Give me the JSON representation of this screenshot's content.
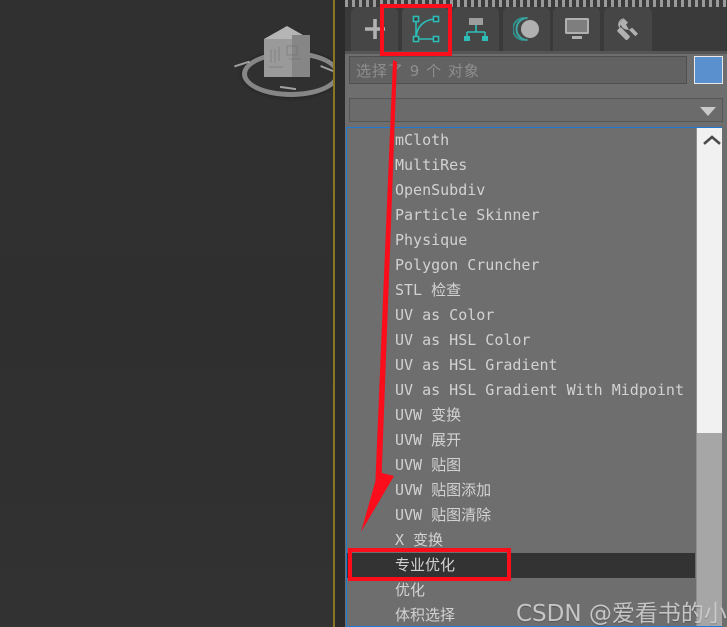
{
  "app": {
    "name": "3ds Max Command Panel",
    "accent_blue": "#1e7ad4",
    "panel_bg": "#6e6e6e",
    "annotation_red": "#fb0d1b",
    "swatch_color": "#5a90ce",
    "tab_icon_teal": "#2dbdb6"
  },
  "viewport": {
    "label": "viewport-3d",
    "object": "cube-with-ring"
  },
  "tabs": [
    {
      "id": "create",
      "icon": "plus-icon",
      "label": "创建",
      "selected": false
    },
    {
      "id": "modify",
      "icon": "modify-icon",
      "label": "修改",
      "selected": true
    },
    {
      "id": "hierarchy",
      "icon": "hierarchy-icon",
      "label": "层次",
      "selected": false
    },
    {
      "id": "motion",
      "icon": "motion-icon",
      "label": "运动",
      "selected": false
    },
    {
      "id": "display",
      "icon": "display-icon",
      "label": "显示",
      "selected": false
    },
    {
      "id": "utilities",
      "icon": "wrench-icon",
      "label": "工具",
      "selected": false
    }
  ],
  "name_field": {
    "value": "选择了 9 个 对象",
    "placeholder": "选择了 9 个 对象",
    "color_swatch": "#5a90ce"
  },
  "modifier_dropdown": {
    "value": "",
    "caret_icon": "chevron-down-icon"
  },
  "modifier_list": {
    "items": [
      "mCloth",
      "MultiRes",
      "OpenSubdiv",
      "Particle Skinner",
      "Physique",
      "Polygon Cruncher",
      "STL 检查",
      "UV as Color",
      "UV as HSL Color",
      "UV as HSL Gradient",
      "UV as HSL Gradient With Midpoint",
      "UVW 变换",
      "UVW 展开",
      "UVW 贴图",
      "UVW 贴图添加",
      "UVW 贴图清除",
      "X 变换",
      "专业优化",
      "优化",
      "体积选择"
    ],
    "selected_index": 17,
    "selected_label": "专业优化"
  },
  "scrollbar": {
    "up_icon": "chevron-up-icon",
    "thumb_position": "bottom"
  },
  "annotations": {
    "tab_highlight_target": "modify-tab",
    "row_highlight_target": "专业优化",
    "arrow": "red-down-arrow"
  },
  "watermark": {
    "text": "CSDN @爱看书的小沐"
  }
}
